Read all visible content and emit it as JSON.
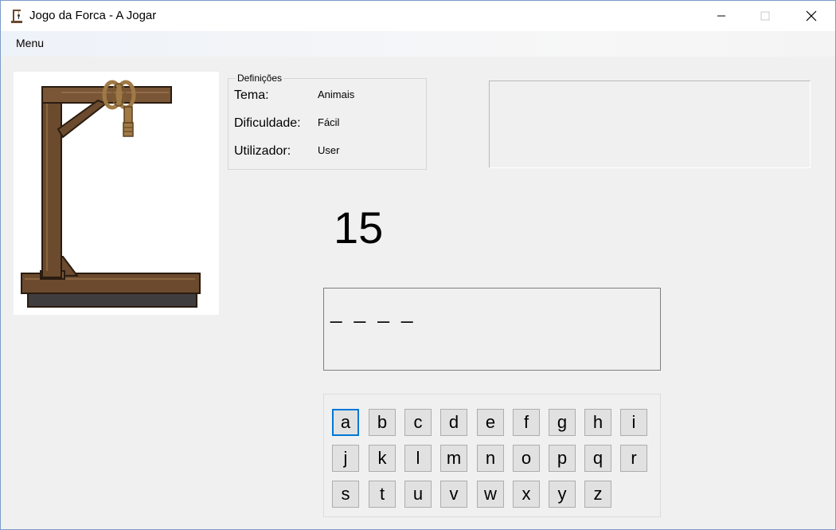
{
  "window": {
    "title": "Jogo da Forca - A Jogar",
    "controls": {
      "minimize": "minimize-icon",
      "maximize": "maximize-icon",
      "close": "close-icon"
    }
  },
  "menubar": {
    "items": [
      {
        "label": "Menu"
      }
    ]
  },
  "settings": {
    "legend": "Definições",
    "rows": [
      {
        "label": "Tema:",
        "value": "Animais"
      },
      {
        "label": "Dificuldade:",
        "value": "Fácil"
      },
      {
        "label": "Utilizador:",
        "value": "User"
      }
    ]
  },
  "message": "",
  "attempts": "15",
  "word": "_ _ _ _",
  "keyboard": {
    "rows": [
      [
        "a",
        "b",
        "c",
        "d",
        "e",
        "f",
        "g",
        "h",
        "i"
      ],
      [
        "j",
        "k",
        "l",
        "m",
        "n",
        "o",
        "p",
        "q",
        "r"
      ],
      [
        "s",
        "t",
        "u",
        "v",
        "w",
        "x",
        "y",
        "z"
      ]
    ],
    "focused": "a"
  },
  "colors": {
    "focus_border": "#0078d7",
    "wood": "#6b4a2e",
    "window_bg": "#f0f0f0"
  }
}
